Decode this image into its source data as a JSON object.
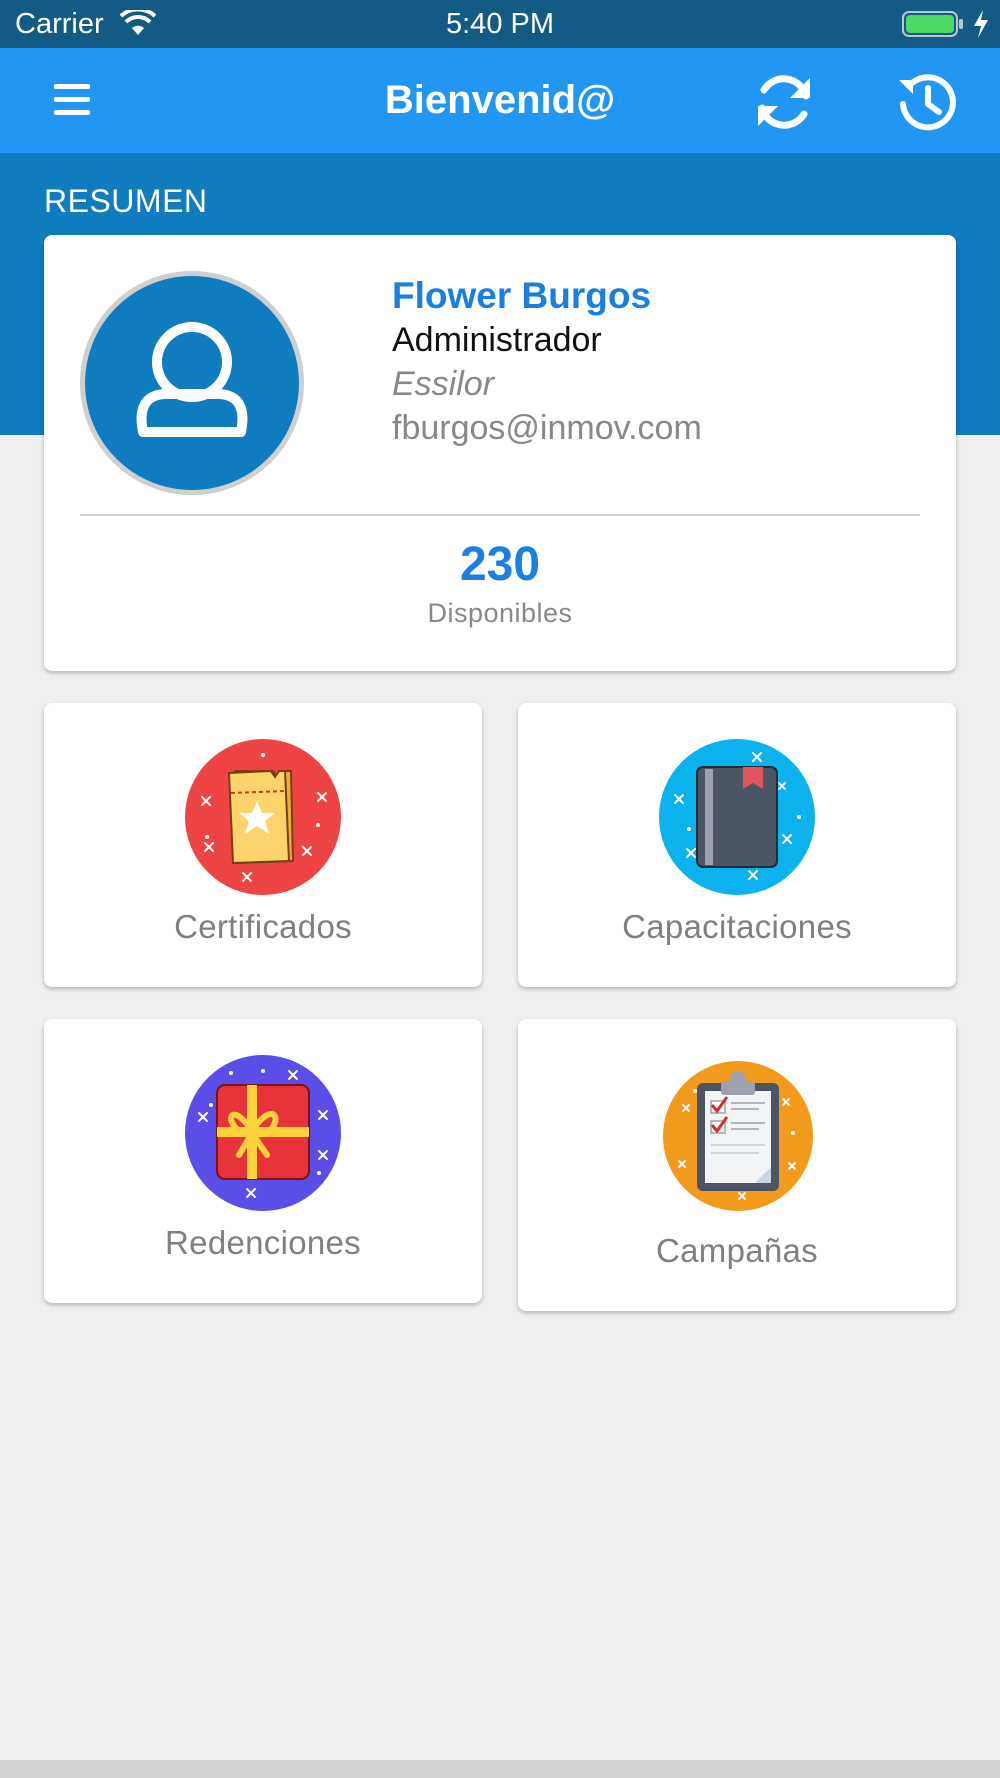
{
  "status_bar": {
    "carrier": "Carrier",
    "time": "5:40 PM",
    "battery_color": "#4cd964"
  },
  "app_bar": {
    "title": "Bienvenid@",
    "menu_icon": "hamburger-menu-icon",
    "refresh_icon": "refresh-icon",
    "history_icon": "history-icon",
    "color": "#2196f3"
  },
  "summary": {
    "section_title": "RESUMEN",
    "hero_color": "#0f7cc0"
  },
  "profile": {
    "name": "Flower Burgos",
    "role": "Administrador",
    "company": "Essilor",
    "email": "fburgos@inmov.com",
    "avatar_icon": "user-avatar-icon",
    "points_value": "230",
    "points_label": "Disponibles"
  },
  "tiles": [
    {
      "label": "Certificados",
      "icon": "certificate-ticket-icon",
      "color": "#ef4444"
    },
    {
      "label": "Capacitaciones",
      "icon": "book-icon",
      "color": "#0bb2ee"
    },
    {
      "label": "Redenciones",
      "icon": "gift-icon",
      "color": "#5b4ee8"
    },
    {
      "label": "Campañas",
      "icon": "clipboard-checklist-icon",
      "color": "#f29a1c"
    }
  ]
}
